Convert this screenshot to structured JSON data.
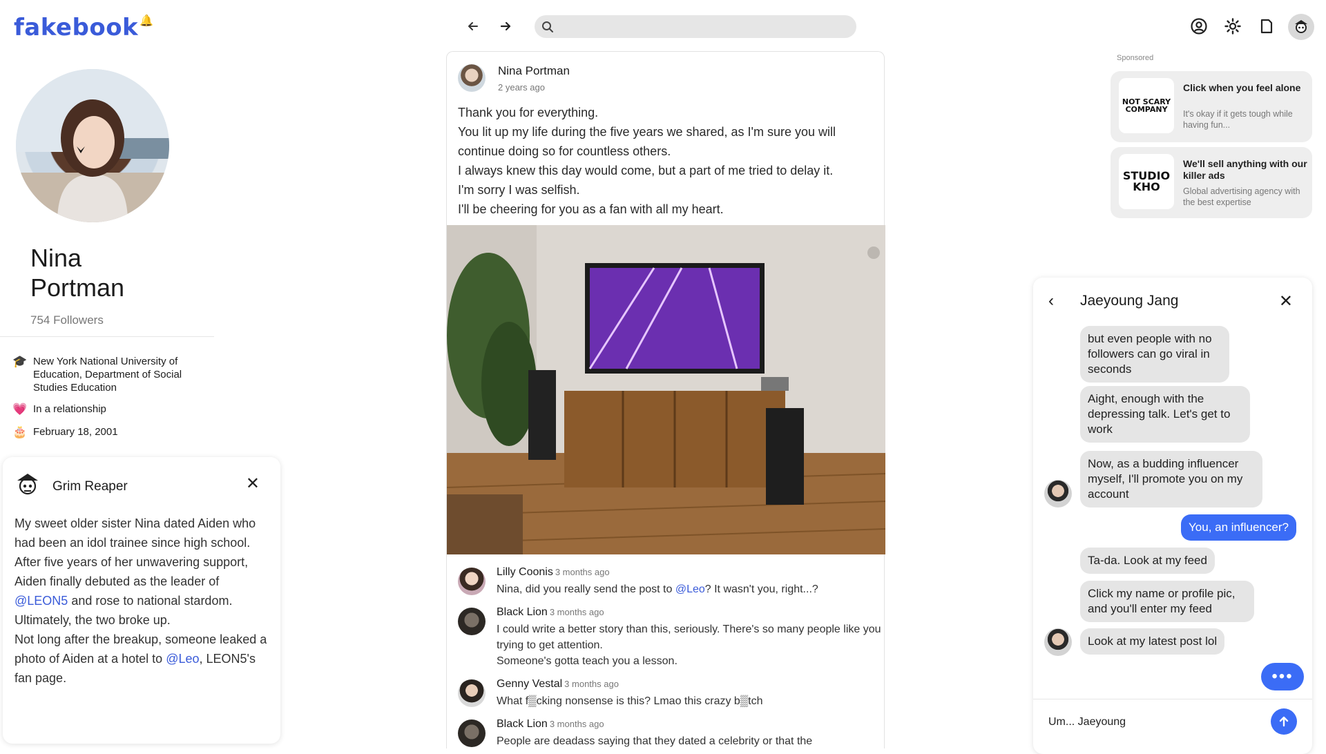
{
  "app": {
    "logo": "fakebook",
    "search_placeholder": ""
  },
  "profile": {
    "name": "Nina Portman",
    "followers": "754 Followers",
    "education": "New York National University of Education, Department of Social Studies Education",
    "relationship": "In a relationship",
    "birthday": "February 18, 2001"
  },
  "grim_card": {
    "name": "Grim Reaper",
    "lines": {
      "l1": "My sweet older sister Nina dated Aiden who had been an idol trainee since high school. After five years of her unwavering support,",
      "l2a": "Aiden finally debuted as the leader of ",
      "l2m": "@LEON5",
      "l2b": " and rose to national stardom.",
      "l3": "Ultimately, the two broke up.",
      "l4": "Not long after the breakup, someone leaked a photo of Aiden at a hotel to ",
      "l4m": "@Leo",
      "l4b": ", LEON5's fan page."
    }
  },
  "post": {
    "author": "Nina Portman",
    "time": "2 years ago",
    "lines": [
      "Thank you for everything.",
      "You lit up my life during the five years we shared, as I'm sure you will continue doing so for countless others.",
      "I always knew this day would come, but a part of me tried to delay it.",
      "I'm sorry I was selfish.",
      "I'll be cheering for you as a fan with all my heart."
    ],
    "comments": [
      {
        "name": "Lilly Coonis",
        "time": "3 months ago",
        "pre": "Nina, did you really send the post to ",
        "mention": "@Leo",
        "post": "? It wasn't you, right...?"
      },
      {
        "name": "Black Lion",
        "time": "3 months ago",
        "text": "I could write a better story than this, seriously. There's so many people like you trying to get attention.",
        "text2": "Someone's gotta teach you a lesson."
      },
      {
        "name": "Genny Vestal",
        "time": "3 months ago",
        "text": "What f▒cking nonsense is this? Lmao this crazy b▒tch"
      },
      {
        "name": "Black Lion",
        "time": "3 months ago",
        "text": "People are deadass saying that they dated a celebrity or that the"
      }
    ]
  },
  "sponsored": {
    "label": "Sponsored",
    "ads": [
      {
        "thumb": "NOT SCARY COMPANY",
        "title": "Click when you feel alone",
        "desc": "It's okay if it gets tough while having fun..."
      },
      {
        "thumb": "STUDIO KHO",
        "title": "We'll sell anything with our killer ads",
        "desc": "Global advertising agency with the best expertise"
      }
    ]
  },
  "chat": {
    "title": "Jaeyoung Jang",
    "messages": [
      "but even people with no followers can go viral in seconds",
      "Aight, enough with the depressing talk. Let's get to work",
      "Now, as a budding influencer myself, I'll promote you on my account",
      "You, an influencer?",
      "Ta-da. Look at my feed",
      "Click my name or profile pic, and you'll enter my feed",
      "Look at my latest post lol"
    ],
    "typing": "•••",
    "input_value": "Um... Jaeyoung"
  }
}
